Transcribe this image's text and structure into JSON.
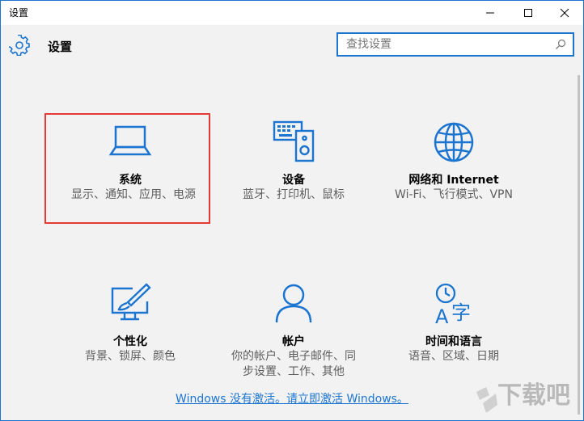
{
  "window": {
    "title": "设置"
  },
  "header": {
    "title": "设置"
  },
  "search": {
    "placeholder": "查找设置"
  },
  "tiles": [
    {
      "name": "系统",
      "desc": "显示、通知、应用、电源",
      "icon": "laptop-icon"
    },
    {
      "name": "设备",
      "desc": "蓝牙、打印机、鼠标",
      "icon": "keyboard-speaker-icon"
    },
    {
      "name": "网络和 Internet",
      "desc": "Wi-Fi、飞行模式、VPN",
      "icon": "globe-icon"
    },
    {
      "name": "个性化",
      "desc": "背景、锁屏、颜色",
      "icon": "monitor-brush-icon"
    },
    {
      "name": "帐户",
      "desc": "你的帐户、电子邮件、同步设置、工作、其他",
      "icon": "person-icon"
    },
    {
      "name": "时间和语言",
      "desc": "语音、区域、日期",
      "icon": "clock-language-icon"
    }
  ],
  "activation": {
    "text": "Windows 没有激活。请立即激活 Windows。"
  },
  "colors": {
    "accent": "#1b75d0",
    "highlight": "#e53935",
    "background": "#f2f2f2"
  },
  "watermark": {
    "text": "下载吧"
  }
}
